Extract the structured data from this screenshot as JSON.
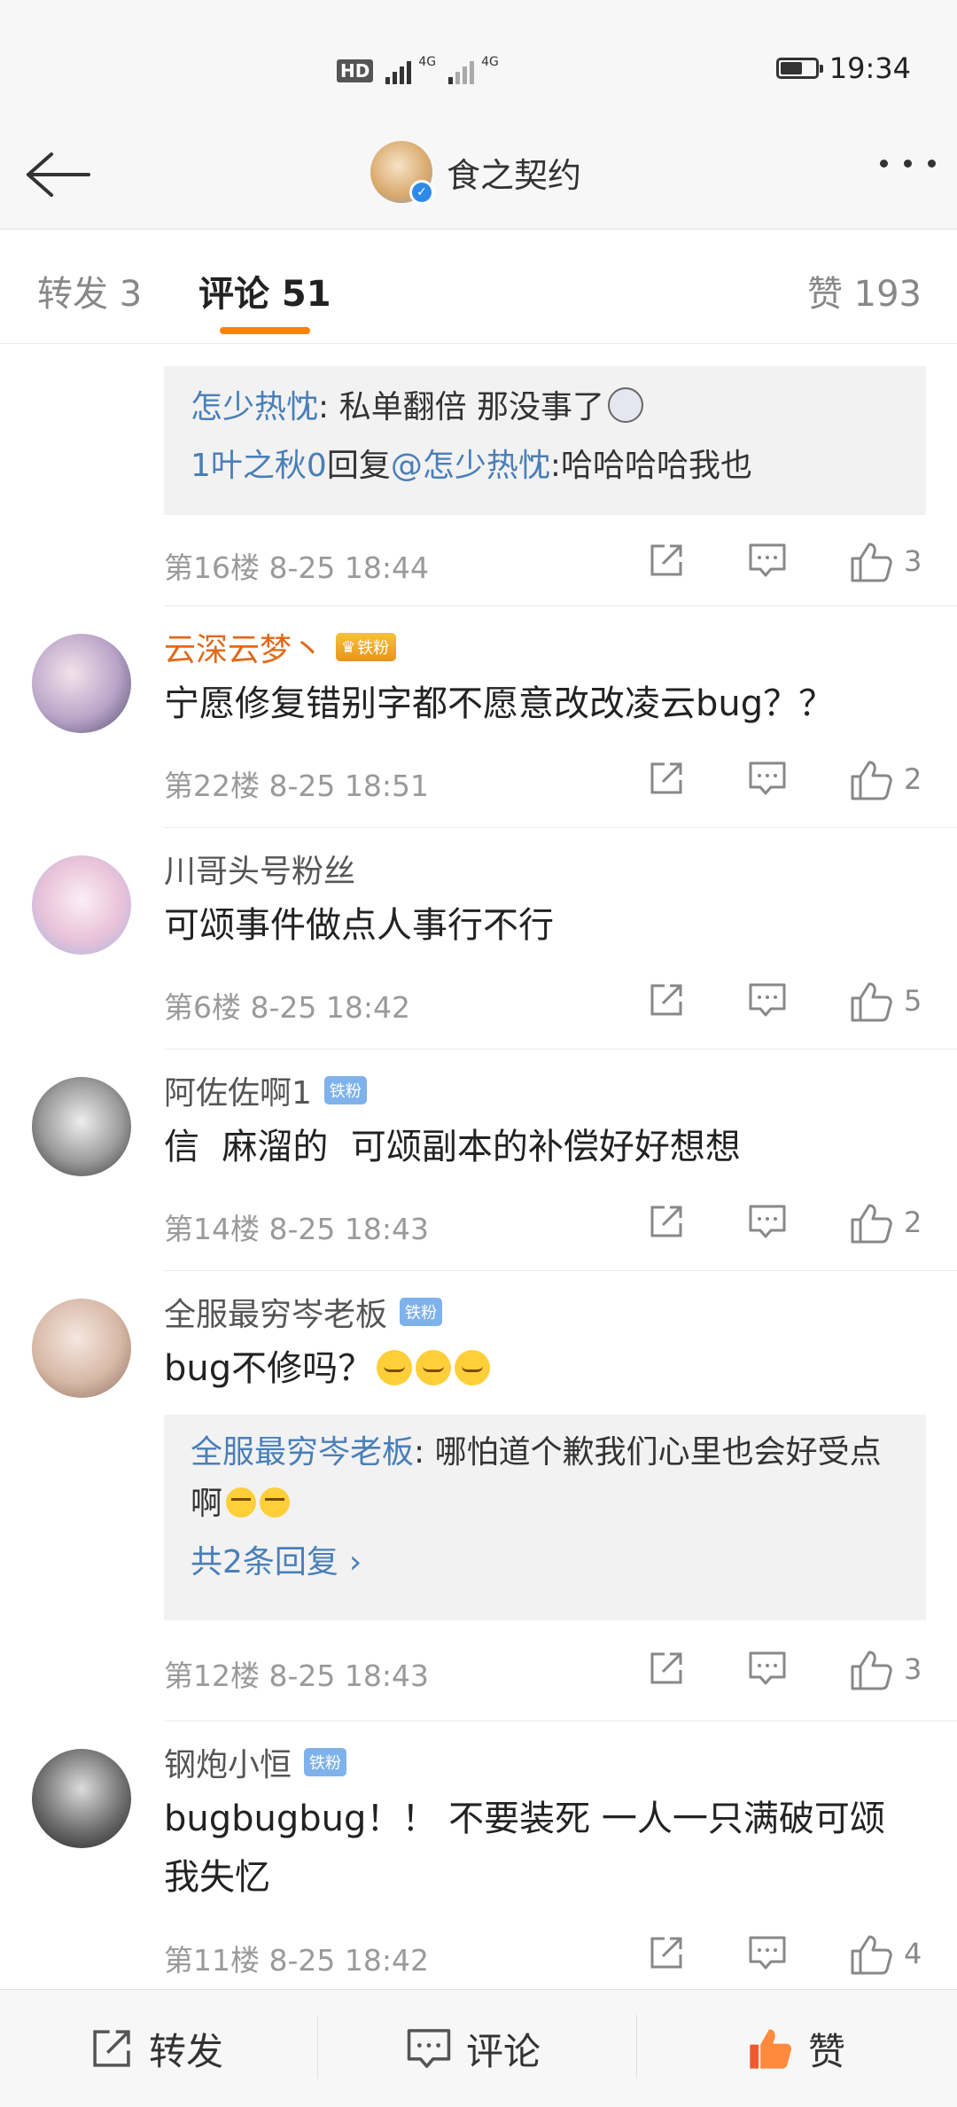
{
  "status_bar": {
    "time": "19:34",
    "hd_label": "HD",
    "network_1": "4G",
    "network_2": "4G"
  },
  "nav": {
    "title": "食之契约"
  },
  "tabs": [
    {
      "label": "转发 3"
    },
    {
      "label": "评论 51"
    },
    {
      "label": "赞 193"
    }
  ],
  "colors": {
    "accent": "#ff8200",
    "link": "#4a7fb8",
    "meta": "#9a9a9a",
    "vip_name": "#e06a1b"
  },
  "badges": {
    "tie": "铁粉"
  },
  "comments": [
    {
      "reply_preview": {
        "line1_user": "怎少热忱",
        "line1_text": ": 私单翻倍 那没事了",
        "line2_user": "1叶之秋0",
        "line2_mid": "回复",
        "line2_mention": "@怎少热忱",
        "line2_text": ":哈哈哈哈我也"
      },
      "floor_time": "第16楼 8-25 18:44",
      "likes": "3"
    },
    {
      "username": "云深云梦丶",
      "badge": "铁粉",
      "text": "宁愿修复错别字都不愿意改改凌云bug？？",
      "floor_time": "第22楼 8-25 18:51",
      "likes": "2"
    },
    {
      "username": "川哥头号粉丝",
      "text": "可颂事件做点人事行不行",
      "floor_time": "第6楼 8-25 18:42",
      "likes": "5"
    },
    {
      "username": "阿佐佐啊1",
      "badge": "铁粉",
      "text": "信  麻溜的  可颂副本的补偿好好想想",
      "floor_time": "第14楼 8-25 18:43",
      "likes": "2"
    },
    {
      "username": "全服最穷岑老板",
      "badge": "铁粉",
      "text": "bug不修吗？",
      "reply_preview": {
        "user": "全服最穷岑老板",
        "text": ": 哪怕道个歉我们心里也会好受点啊",
        "more": "共2条回复"
      },
      "floor_time": "第12楼 8-25 18:43",
      "likes": "3"
    },
    {
      "username": "钢炮小恒",
      "badge": "铁粉",
      "text": "bugbugbug！！ 不要装死 一人一只满破可颂 我失忆",
      "floor_time": "第11楼 8-25 18:42",
      "likes": "4"
    }
  ],
  "bottom": {
    "repost": "转发",
    "comment": "评论",
    "like": "赞"
  }
}
